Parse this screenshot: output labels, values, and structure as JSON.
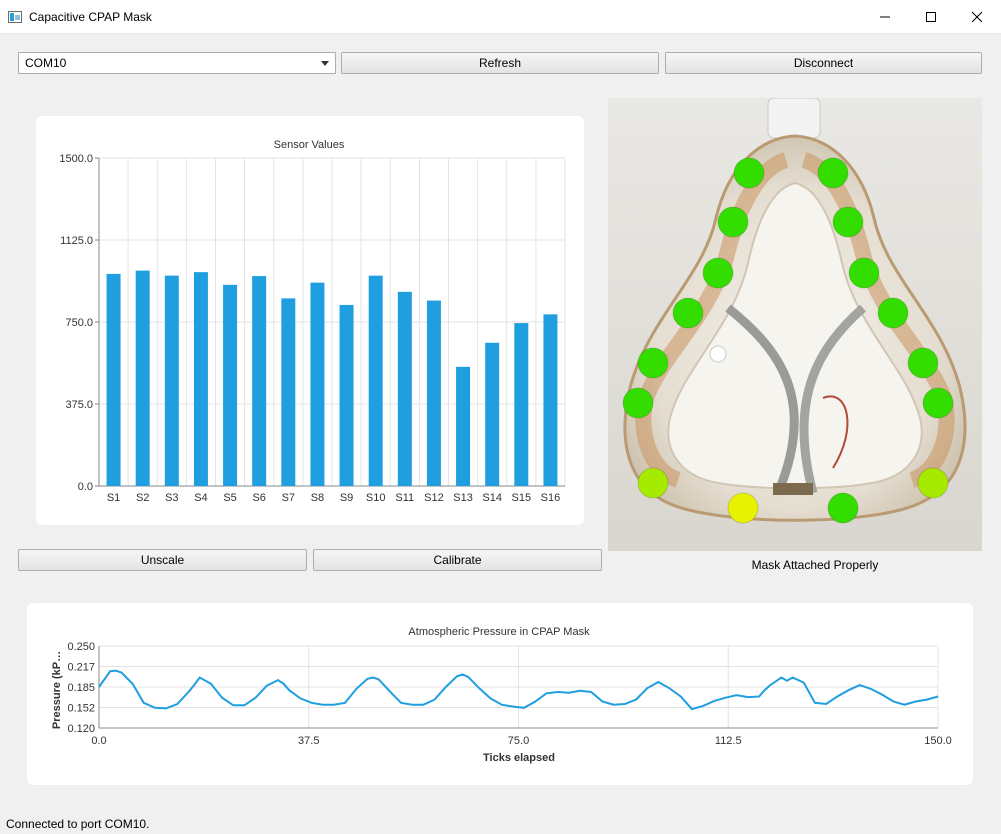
{
  "window": {
    "title": "Capacitive CPAP Mask"
  },
  "icons": {
    "app": "app-window-icon",
    "minimize": "minimize-icon",
    "maximize": "maximize-icon",
    "close": "close-icon",
    "dropdown": "chevron-down-icon"
  },
  "toolbar": {
    "port_value": "COM10",
    "refresh_label": "Refresh",
    "disconnect_label": "Disconnect"
  },
  "actions": {
    "unscale_label": "Unscale",
    "calibrate_label": "Calibrate"
  },
  "colors": {
    "bar": "#1f9ee0",
    "line": "#1f9ee0",
    "sensor_ok": "#33dd00",
    "sensor_warn": "#a6ea00",
    "sensor_alert": "#e6f200"
  },
  "mask": {
    "status": "Mask Attached Properly",
    "sensor_states": [
      "ok",
      "ok",
      "ok",
      "ok",
      "ok",
      "ok",
      "ok",
      "ok",
      "ok",
      "ok",
      "ok",
      "ok",
      "warn",
      "alert",
      "ok",
      "warn"
    ]
  },
  "status_bar": "Connected to port COM10.",
  "chart_data": [
    {
      "type": "bar",
      "title": "Sensor Values",
      "categories": [
        "S1",
        "S2",
        "S3",
        "S4",
        "S5",
        "S6",
        "S7",
        "S8",
        "S9",
        "S10",
        "S11",
        "S12",
        "S13",
        "S14",
        "S15",
        "S16"
      ],
      "values": [
        970,
        985,
        962,
        978,
        920,
        960,
        858,
        930,
        828,
        962,
        888,
        848,
        545,
        655,
        745,
        785
      ],
      "ylim": [
        0,
        1500
      ],
      "yticks": [
        "0.0",
        "375.0",
        "750.0",
        "1125.0",
        "1500.0"
      ],
      "grid": true
    },
    {
      "type": "line",
      "title": "Atmospheric Pressure in CPAP Mask",
      "xlabel": "Ticks elapsed",
      "ylabel": "Pressure (kP…",
      "xlim": [
        0,
        150
      ],
      "ylim": [
        0.12,
        0.25
      ],
      "xticks": [
        "0.0",
        "37.5",
        "75.0",
        "112.5",
        "150.0"
      ],
      "yticks": [
        "0.120",
        "0.152",
        "0.185",
        "0.217",
        "0.250"
      ],
      "grid": true,
      "x": [
        0,
        2,
        3,
        4,
        6,
        8,
        10,
        12,
        14,
        16,
        17,
        18,
        20,
        22,
        24,
        26,
        28,
        30,
        32,
        33,
        34,
        36,
        38,
        40,
        42,
        44,
        46,
        48,
        49,
        50,
        52,
        54,
        56,
        58,
        60,
        62,
        64,
        65,
        66,
        68,
        70,
        72,
        74,
        76,
        78,
        80,
        82,
        84,
        86,
        88,
        90,
        92,
        94,
        96,
        98,
        100,
        102,
        104,
        106,
        108,
        110,
        112,
        114,
        116,
        118,
        119,
        120,
        122,
        123,
        124,
        126,
        128,
        130,
        132,
        134,
        136,
        138,
        140,
        142,
        144,
        146,
        148,
        150
      ],
      "y": [
        0.185,
        0.21,
        0.211,
        0.208,
        0.19,
        0.16,
        0.152,
        0.151,
        0.158,
        0.177,
        0.188,
        0.2,
        0.19,
        0.168,
        0.156,
        0.156,
        0.168,
        0.187,
        0.196,
        0.19,
        0.18,
        0.167,
        0.16,
        0.157,
        0.157,
        0.16,
        0.182,
        0.198,
        0.2,
        0.197,
        0.178,
        0.16,
        0.157,
        0.157,
        0.165,
        0.185,
        0.202,
        0.205,
        0.201,
        0.183,
        0.167,
        0.157,
        0.154,
        0.152,
        0.162,
        0.175,
        0.177,
        0.176,
        0.179,
        0.177,
        0.162,
        0.157,
        0.158,
        0.165,
        0.183,
        0.193,
        0.183,
        0.17,
        0.15,
        0.155,
        0.163,
        0.168,
        0.172,
        0.169,
        0.17,
        0.18,
        0.188,
        0.2,
        0.195,
        0.2,
        0.192,
        0.16,
        0.158,
        0.17,
        0.18,
        0.188,
        0.182,
        0.173,
        0.162,
        0.157,
        0.162,
        0.165,
        0.17
      ]
    }
  ]
}
